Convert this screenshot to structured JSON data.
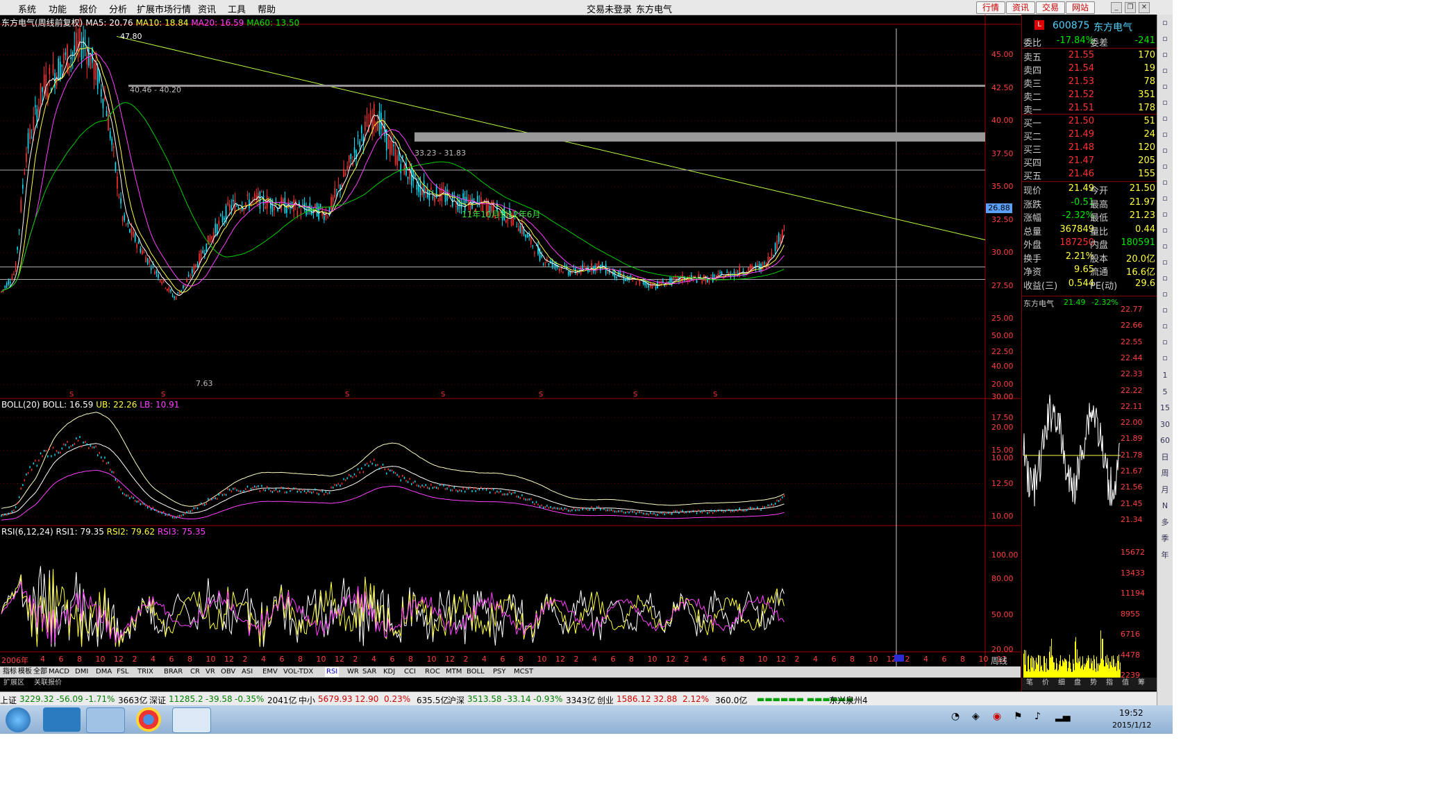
{
  "menu": {
    "items": [
      "系统",
      "功能",
      "报价",
      "分析",
      "扩展市场行情",
      "资讯",
      "工具",
      "帮助"
    ],
    "login_status": "交易未登录",
    "stock_name": "东方电气",
    "top_buttons": [
      "行情",
      "资讯",
      "交易",
      "网站"
    ]
  },
  "main_chart": {
    "legend_title": "东方电气(周线前复权)",
    "ma5": "MA5: 20.76",
    "ma10": "MA10: 18.84",
    "ma20": "MA20: 16.59",
    "ma60": "MA60: 13.50",
    "peak_label": "47.80",
    "band1_label": "40.46 - 40.20",
    "band2_label": "33.23 - 31.83",
    "annotation": "11年10月到12年6月",
    "low_label": "7.63",
    "price_ticks": [
      "45.00",
      "42.50",
      "40.00",
      "37.50",
      "35.00",
      "32.50",
      "30.00",
      "27.50",
      "25.00",
      "22.50",
      "20.00",
      "17.50",
      "15.00",
      "12.50",
      "10.00"
    ],
    "current_price_tag": "26.88"
  },
  "boll_chart": {
    "legend": "BOLL(20)",
    "boll": "BOLL: 16.59",
    "ub": "UB: 22.26",
    "lb": "LB: 10.91",
    "ticks": [
      "50.00",
      "40.00",
      "30.00",
      "20.00",
      "10.00"
    ]
  },
  "rsi_chart": {
    "legend": "RSI(6,12,24)",
    "rsi1": "RSI1: 79.35",
    "rsi2": "RSI2: 79.62",
    "rsi3": "RSI3: 75.35",
    "ticks": [
      "100.00",
      "80.00",
      "50.00",
      "20.00"
    ]
  },
  "time_axis": {
    "start": "2006年",
    "period_label": "周线",
    "labels": [
      "4",
      "6",
      "8",
      "10",
      "12",
      "2",
      "4",
      "6",
      "8",
      "10",
      "12",
      "2",
      "4",
      "6",
      "8",
      "10",
      "12",
      "2",
      "4",
      "6",
      "8",
      "10",
      "12",
      "2",
      "4",
      "6",
      "8",
      "10",
      "12",
      "2",
      "4",
      "6",
      "8",
      "10",
      "12",
      "2",
      "4",
      "6",
      "8",
      "10",
      "12",
      "2",
      "4",
      "6",
      "8",
      "10",
      "12",
      "2",
      "4",
      "6",
      "8",
      "10",
      "12"
    ]
  },
  "indicator_tabs": [
    "指标",
    "模板",
    "全部",
    "MACD",
    "DMI",
    "DMA",
    "FSL",
    "TRIX",
    "BRAR",
    "CR",
    "VR",
    "OBV",
    "ASI",
    "EMV",
    "VOL-TDX",
    "RSI",
    "WR",
    "SAR",
    "KDJ",
    "CCI",
    "ROC",
    "MTM",
    "BOLL",
    "PSY",
    "MCST"
  ],
  "sub_tabs": [
    "扩展区",
    "关联报价"
  ],
  "quote": {
    "code": "600875",
    "name": "东方电气",
    "wb_label": "委比",
    "wb_value": "-17.84%",
    "wc_label": "委差",
    "wc_value": "-241",
    "asks": [
      {
        "label": "卖五",
        "price": "21.55",
        "vol": "170"
      },
      {
        "label": "卖四",
        "price": "21.54",
        "vol": "19"
      },
      {
        "label": "卖三",
        "price": "21.53",
        "vol": "78"
      },
      {
        "label": "卖二",
        "price": "21.52",
        "vol": "351"
      },
      {
        "label": "卖一",
        "price": "21.51",
        "vol": "178"
      }
    ],
    "bids": [
      {
        "label": "买一",
        "price": "21.50",
        "vol": "51"
      },
      {
        "label": "买二",
        "price": "21.49",
        "vol": "24"
      },
      {
        "label": "买三",
        "price": "21.48",
        "vol": "120"
      },
      {
        "label": "买四",
        "price": "21.47",
        "vol": "205"
      },
      {
        "label": "买五",
        "price": "21.46",
        "vol": "155"
      }
    ],
    "stats": [
      {
        "l1": "现价",
        "v1": "21.49",
        "l2": "今开",
        "v2": "21.50"
      },
      {
        "l1": "涨跌",
        "v1": "-0.51",
        "l2": "最高",
        "v2": "21.97"
      },
      {
        "l1": "涨幅",
        "v1": "-2.32%",
        "l2": "最低",
        "v2": "21.23"
      },
      {
        "l1": "总量",
        "v1": "367849",
        "l2": "量比",
        "v2": "0.44"
      },
      {
        "l1": "外盘",
        "v1": "187250",
        "l2": "内盘",
        "v2": "180591"
      },
      {
        "l1": "换手",
        "v1": "2.21%",
        "l2": "股本",
        "v2": "20.0亿"
      },
      {
        "l1": "净资",
        "v1": "9.65",
        "l2": "流通",
        "v2": "16.6亿"
      },
      {
        "l1": "收益(三)",
        "v1": "0.544",
        "l2": "PE(动)",
        "v2": "29.6"
      }
    ],
    "mini_title": "东方电气",
    "mini_price": "21.49",
    "mini_change": "-2.32%",
    "mini_price_ticks": [
      "22.77",
      "22.66",
      "22.55",
      "22.44",
      "22.33",
      "22.22",
      "22.11",
      "22.00",
      "21.89",
      "21.78",
      "21.67",
      "21.56",
      "21.45",
      "21.34"
    ],
    "mini_vol_ticks": [
      "15672",
      "13433",
      "11194",
      "8955",
      "6716",
      "4478",
      "2239"
    ],
    "bottom_tabs": [
      "笔",
      "价",
      "细",
      "盘",
      "势",
      "指",
      "值",
      "筹"
    ]
  },
  "right_toolbar": [
    "1",
    "5",
    "15",
    "30",
    "60",
    "日",
    "周",
    "月",
    "N",
    "多",
    "季",
    "年"
  ],
  "ticker": [
    {
      "name": "上证",
      "value": "3229.32",
      "chg": "-56.09",
      "pct": "-1.71%",
      "amt": "3663亿"
    },
    {
      "name": "深证",
      "value": "11285.2",
      "chg": "-39.58",
      "pct": "-0.35%",
      "amt": "2041亿"
    },
    {
      "name": "中小",
      "value": "5679.93",
      "chg": "12.90",
      "pct": "0.23%",
      "amt": "635.5亿"
    },
    {
      "name": "沪深",
      "value": "3513.58",
      "chg": "-33.14",
      "pct": "-0.93%",
      "amt": "3343亿"
    },
    {
      "name": "创业",
      "value": "1586.12",
      "chg": "32.88",
      "pct": "2.12%",
      "amt": "360.0亿"
    }
  ],
  "ticker_extra": "东兴泉州4",
  "taskbar": {
    "time": "19:52",
    "date": "2015/1/12"
  },
  "colors": {
    "up": "#ff3232",
    "down": "#00e6ff",
    "ma5": "#ffffff",
    "ma10": "#ffff40",
    "ma20": "#ff40ff",
    "ma60": "#00d000",
    "trend": "#c0ff40"
  }
}
